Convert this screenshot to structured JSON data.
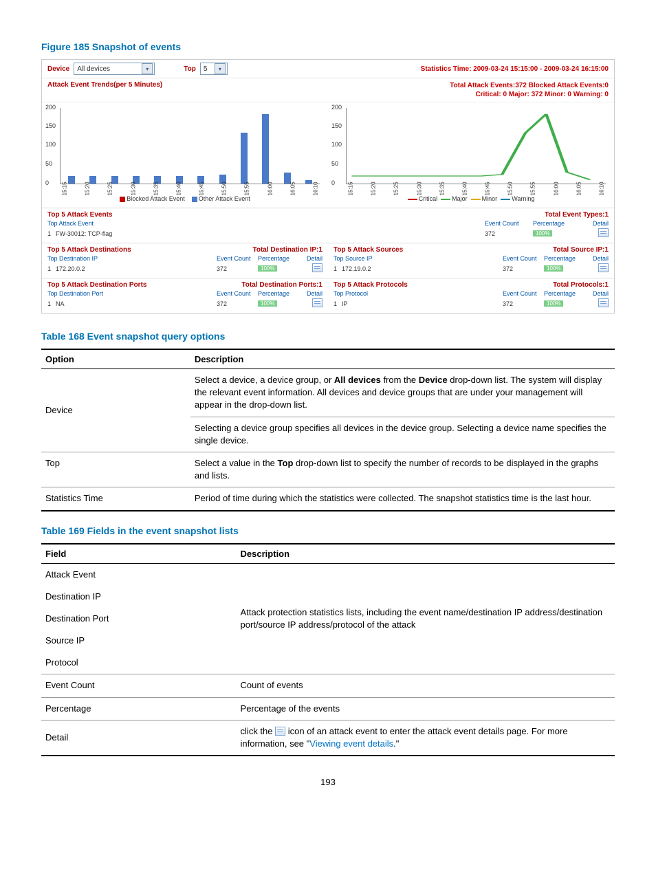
{
  "figure_title": "Figure 185 Snapshot of events",
  "table168_title": "Table 168 Event snapshot query options",
  "table169_title": "Table 169 Fields in the event snapshot lists",
  "page_number": "193",
  "shot": {
    "device_label": "Device",
    "device_value": "All devices",
    "top_label": "Top",
    "top_value": "5",
    "stats_time_label": "Statistics Time: 2009-03-24 15:15:00 - 2009-03-24 16:15:00",
    "trends_title": "Attack Event Trends(per 5 Minutes)",
    "totals_line1": "Total Attack Events:372 Blocked Attack Events:0",
    "totals_line2": "Critical: 0 Major: 372 Minor: 0 Warning: 0",
    "legend_left_a": "Blocked Attack Event",
    "legend_left_b": "Other Attack Event",
    "legend_right": {
      "critical": "Critical",
      "major": "Major",
      "minor": "Minor",
      "warning": "Warning"
    },
    "top5_events": {
      "title": "Top 5 Attack Events",
      "right": "Total Event Types:1",
      "sub": "Top Attack Event",
      "cols": {
        "ec": "Event Count",
        "pct": "Percentage",
        "det": "Detail"
      },
      "row": {
        "name": "FW-30012: TCP-flag",
        "count": "372",
        "pct": "100%"
      }
    },
    "dest": {
      "title": "Top 5 Attack Destinations",
      "right": "Total Destination IP:1",
      "sub": "Top Destination IP",
      "ec": "Event Count",
      "pct": "Percentage",
      "det": "Detail",
      "row": {
        "name": "172.20.0.2",
        "count": "372",
        "pct": "100%"
      }
    },
    "src": {
      "title": "Top 5 Attack Sources",
      "right": "Total Source IP:1",
      "sub": "Top Source IP",
      "ec": "Event Count",
      "pct": "Percentage",
      "det": "Detail",
      "row": {
        "name": "172.19.0.2",
        "count": "372",
        "pct": "100%"
      }
    },
    "port": {
      "title": "Top 5 Attack Destination Ports",
      "right": "Total Destination Ports:1",
      "sub": "Top Destination Port",
      "ec": "Event Count",
      "pct": "Percentage",
      "det": "Detail",
      "row": {
        "name": "NA",
        "count": "372",
        "pct": "100%"
      }
    },
    "proto": {
      "title": "Top 5 Attack Protocols",
      "right": "Total Protocols:1",
      "sub": "Top Protocol",
      "ec": "Event Count",
      "pct": "Percentage",
      "det": "Detail",
      "row": {
        "name": "IP",
        "count": "372",
        "pct": "100%"
      }
    }
  },
  "chart_data": [
    {
      "type": "bar",
      "title": "Attack Event Trends(per 5 Minutes)",
      "xlabel": "",
      "ylabel": "",
      "ylim": [
        0,
        200
      ],
      "categories": [
        "15:15",
        "15:20",
        "15:25",
        "15:30",
        "15:35",
        "15:40",
        "15:45",
        "15:50",
        "15:55",
        "16:00",
        "16:05",
        "16:10"
      ],
      "series": [
        {
          "name": "Blocked Attack Event",
          "values": [
            0,
            0,
            0,
            0,
            0,
            0,
            0,
            0,
            0,
            0,
            0,
            0
          ]
        },
        {
          "name": "Other Attack Event",
          "values": [
            20,
            20,
            20,
            20,
            20,
            20,
            20,
            25,
            135,
            185,
            30,
            10
          ]
        }
      ]
    },
    {
      "type": "line",
      "title": "Severity trend",
      "xlabel": "",
      "ylabel": "",
      "ylim": [
        0,
        200
      ],
      "categories": [
        "15:15",
        "15:20",
        "15:25",
        "15:30",
        "15:35",
        "15:40",
        "15:45",
        "15:50",
        "15:55",
        "16:00",
        "16:05",
        "16:10"
      ],
      "series": [
        {
          "name": "Critical",
          "values": [
            0,
            0,
            0,
            0,
            0,
            0,
            0,
            0,
            0,
            0,
            0,
            0
          ]
        },
        {
          "name": "Major",
          "values": [
            20,
            20,
            20,
            20,
            20,
            20,
            20,
            25,
            135,
            185,
            30,
            10
          ]
        },
        {
          "name": "Minor",
          "values": [
            0,
            0,
            0,
            0,
            0,
            0,
            0,
            0,
            0,
            0,
            0,
            0
          ]
        },
        {
          "name": "Warning",
          "values": [
            0,
            0,
            0,
            0,
            0,
            0,
            0,
            0,
            0,
            0,
            0,
            0
          ]
        }
      ]
    }
  ],
  "t168": {
    "h_option": "Option",
    "h_desc": "Description",
    "device": "Device",
    "device_p1a": "Select a device, a device group, or ",
    "device_p1b": "All devices",
    "device_p1c": " from the ",
    "device_p1d": "Device",
    "device_p1e": " drop-down list. The system will display the relevant event information. All devices and device groups that are under your management will appear in the drop-down list.",
    "device_p2": "Selecting a device group specifies all devices in the device group. Selecting a device name specifies the single device.",
    "top": "Top",
    "top_p_a": "Select a value in the ",
    "top_p_b": "Top",
    "top_p_c": " drop-down list to specify the number of records to be displayed in the graphs and lists.",
    "stat": "Statistics Time",
    "stat_p": "Period of time during which the statistics were collected. The snapshot statistics time is the last hour."
  },
  "t169": {
    "h_field": "Field",
    "h_desc": "Description",
    "f1": "Attack Event",
    "f2": "Destination IP",
    "f3": "Destination Port",
    "f4": "Source IP",
    "f5": "Protocol",
    "d_list": "Attack protection statistics lists, including the event name/destination IP address/destination port/source IP address/protocol of the attack",
    "f6": "Event Count",
    "d6": "Count of events",
    "f7": "Percentage",
    "d7": "Percentage of the events",
    "f8": "Detail",
    "d8a": "click the ",
    "d8b": " icon of an attack event to enter the attack event details page. For more information, see \"",
    "d8c": "Viewing event details",
    "d8d": ".\""
  }
}
